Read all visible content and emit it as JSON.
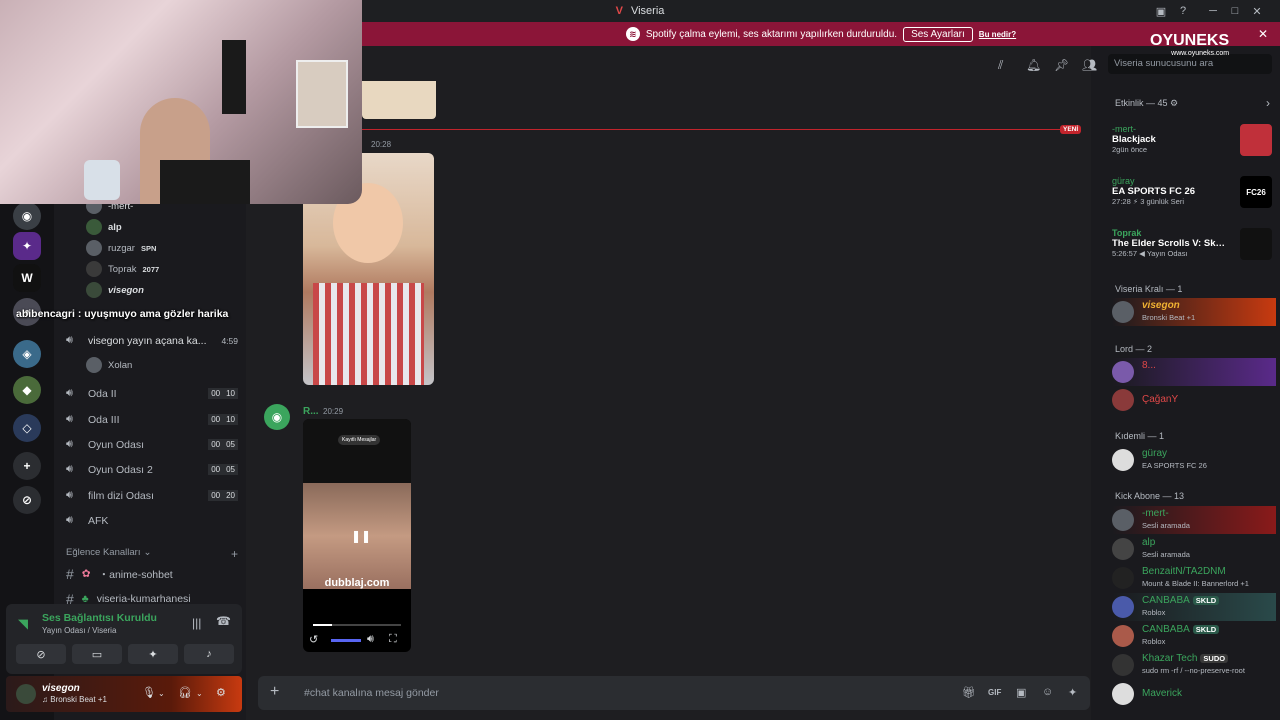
{
  "window": {
    "title": "Viseria",
    "logo": "V"
  },
  "banner": {
    "text": "Spotify çalma eylemi, ses aktarımı yapılırken durduruldu.",
    "button": "Ses Ayarları",
    "link": "Bu nedir?"
  },
  "branding": {
    "name": "OYUNEKS",
    "url": "www.oyuneks.com"
  },
  "search": {
    "placeholder": "Viseria sunucusunu ara"
  },
  "overlay_chat": "abibencagri : uyuşmuyo ama gözler harika",
  "channels": {
    "voice_members_top": [
      {
        "name": "-mert-"
      },
      {
        "name": "alp"
      },
      {
        "name": "ruzgar",
        "badge": "SPN"
      },
      {
        "name": "Toprak",
        "badge": "2077"
      },
      {
        "name": "visegon"
      }
    ],
    "active_channel": {
      "name": "visegon yayın açana ka...",
      "time": "4:59"
    },
    "active_member": "Xolan",
    "voice_channels": [
      {
        "name": "Oda II",
        "c1": "00",
        "c2": "10"
      },
      {
        "name": "Oda III",
        "c1": "00",
        "c2": "10"
      },
      {
        "name": "Oyun Odası",
        "c1": "00",
        "c2": "05"
      },
      {
        "name": "Oyun Odası 2",
        "c1": "00",
        "c2": "05"
      },
      {
        "name": "film dizi Odası",
        "c1": "00",
        "c2": "20"
      },
      {
        "name": "AFK"
      }
    ],
    "category": "Eğlence Kanalları",
    "text_channels": [
      "・anime-sohbet",
      "viseria-kumarhanesi"
    ]
  },
  "voice_panel": {
    "status": "Ses Bağlantısı Kuruldu",
    "location": "Yayın Odası / Viseria"
  },
  "user": {
    "name": "visegon",
    "activity": "Bronski Beat",
    "extra": "+1"
  },
  "messages": {
    "first_time": "20:28",
    "new_label": "YENİ",
    "second_author": "R...",
    "second_time": "20:29",
    "video_caption": "dubblaj.com",
    "video_header": "Kayıtlı Mesajlar"
  },
  "composer": {
    "placeholder": "#chat kanalına mesaj gönder"
  },
  "members": {
    "activity_header": "Etkinlik — 45",
    "activities": [
      {
        "user": "-mert-",
        "game": "Blackjack",
        "detail": "2gün önce"
      },
      {
        "user": "güray",
        "game": "EA SPORTS FC 26",
        "detail": "27:28",
        "streak": "3 günlük Seri",
        "thumb_label": "FC26"
      },
      {
        "user": "Toprak",
        "game": "The Elder Scrolls V: Skyrim ...",
        "detail": "5:26:57",
        "extra": "Yayın Odası"
      }
    ],
    "groups": [
      {
        "title": "Viseria Kralı — 1",
        "members": [
          {
            "name": "visegon",
            "status": "Bronski Beat +1",
            "color": "#f0b232"
          }
        ]
      },
      {
        "title": "Lord — 2",
        "members": [
          {
            "name": "8...",
            "status": "",
            "color": "#e04848"
          },
          {
            "name": "ÇağanY",
            "status": "",
            "color": "#e04848"
          }
        ]
      },
      {
        "title": "Kıdemli — 1",
        "members": [
          {
            "name": "güray",
            "status": "EA SPORTS FC 26",
            "color": "#3ba55d"
          }
        ]
      },
      {
        "title": "Kick Abone — 13",
        "members": [
          {
            "name": "-mert-",
            "status": "Sesli aramada",
            "color": "#3ba55d"
          },
          {
            "name": "alp",
            "status": "Sesli aramada",
            "color": "#3ba55d"
          },
          {
            "name": "BenzaitN/TA2DNM",
            "status": "Mount & Blade II: Bannerlord +1",
            "color": "#3ba55d"
          },
          {
            "name": "CANBABA",
            "tag": "SKLD",
            "status": "Roblox",
            "color": "#3ba55d"
          },
          {
            "name": "CANBABA",
            "tag": "SKLD",
            "status": "Roblox",
            "color": "#3ba55d"
          },
          {
            "name": "Khazar Tech",
            "tag": "SUDO",
            "status": "sudo rm -rf / --no-preserve-root",
            "color": "#3ba55d"
          },
          {
            "name": "Maverick",
            "status": "",
            "color": "#3ba55d"
          }
        ]
      }
    ]
  }
}
